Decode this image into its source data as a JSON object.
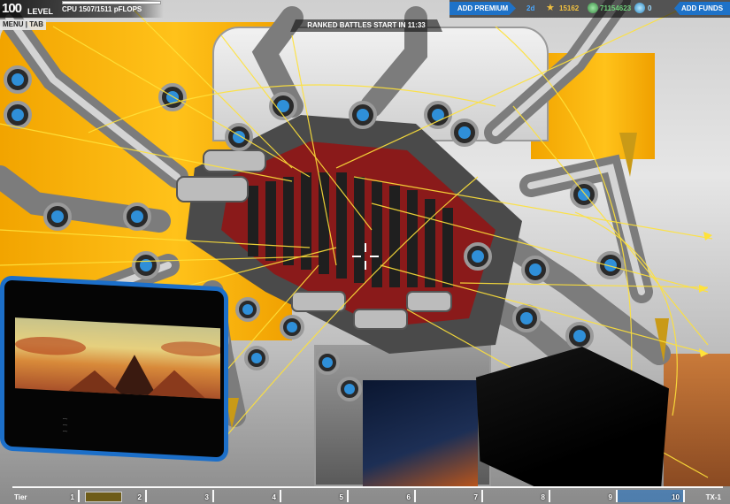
{
  "hud": {
    "level_number": "100",
    "level_label": "LEVEL",
    "cpu_label": "CPU 1507/1511 pFLOPS",
    "cpu_fill_fraction": 0.997,
    "menu_tab": "MENU | TAB",
    "ranked_banner": "RANKED BATTLES START IN 11:33"
  },
  "resources": {
    "add_premium_label": "ADD PREMIUM",
    "premium_days": "2d",
    "rp_icon": "star-icon",
    "rp_value": "15162",
    "robits_icon": "robits-icon",
    "robits_value": "71154623",
    "cosmetic_icon": "cosmetic-credit-icon",
    "cosmetic_value": "0",
    "add_funds_label": "ADD FUNDS"
  },
  "tablet": {
    "image_icon": "planet-landscape-image",
    "caption_lines": [
      "...",
      "...",
      "..."
    ]
  },
  "hotbar": {
    "first_label": "Tier",
    "slots": [
      "1",
      "2",
      "3",
      "4",
      "5",
      "6",
      "7",
      "8",
      "9",
      "10"
    ],
    "active_slot": "10",
    "last_label": "TX-1"
  },
  "colors": {
    "accent_blue": "#1e72c8",
    "rp_gold": "#f0c040",
    "robits_green": "#6fd07a",
    "wall_orange": "#ffb400",
    "laser_yellow": "#ffe23a"
  }
}
